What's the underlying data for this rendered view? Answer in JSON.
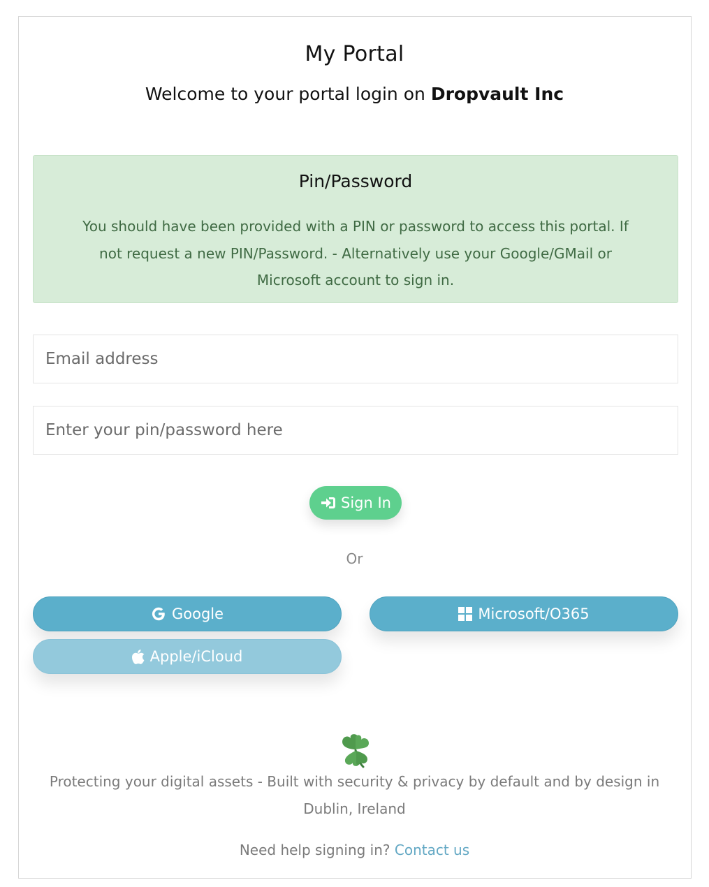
{
  "header": {
    "title": "My Portal",
    "welcome_prefix": "Welcome to your portal login on ",
    "company": "Dropvault Inc"
  },
  "info_box": {
    "heading": "Pin/Password",
    "message": "You should have been provided with a PIN or password to access this portal. If not request a new PIN/Password. - Alternatively use your Google/GMail or Microsoft account to sign in."
  },
  "form": {
    "email_placeholder": "Email address",
    "email_value": "",
    "pin_placeholder": "Enter your pin/password here",
    "pin_value": "",
    "signin_label": "Sign In"
  },
  "divider_text": "Or",
  "sso": {
    "google_label": "Google",
    "microsoft_label": "Microsoft/O365",
    "apple_label": "Apple/iCloud"
  },
  "footer": {
    "tagline": "Protecting your digital assets - Built with security & privacy by default and by design in Dublin, Ireland",
    "help_prefix": "Need help signing in? ",
    "contact_label": "Contact us"
  },
  "colors": {
    "signin_button": "#5ed08e",
    "sso_button": "#5bafcb",
    "apple_button": "#93c9dc",
    "info_background": "#d7ecd8",
    "link": "#63a8c4"
  },
  "icons": {
    "signin": "sign-in-icon",
    "google": "google-icon",
    "microsoft": "windows-icon",
    "apple": "apple-icon",
    "footer": "shamrock-icon"
  }
}
